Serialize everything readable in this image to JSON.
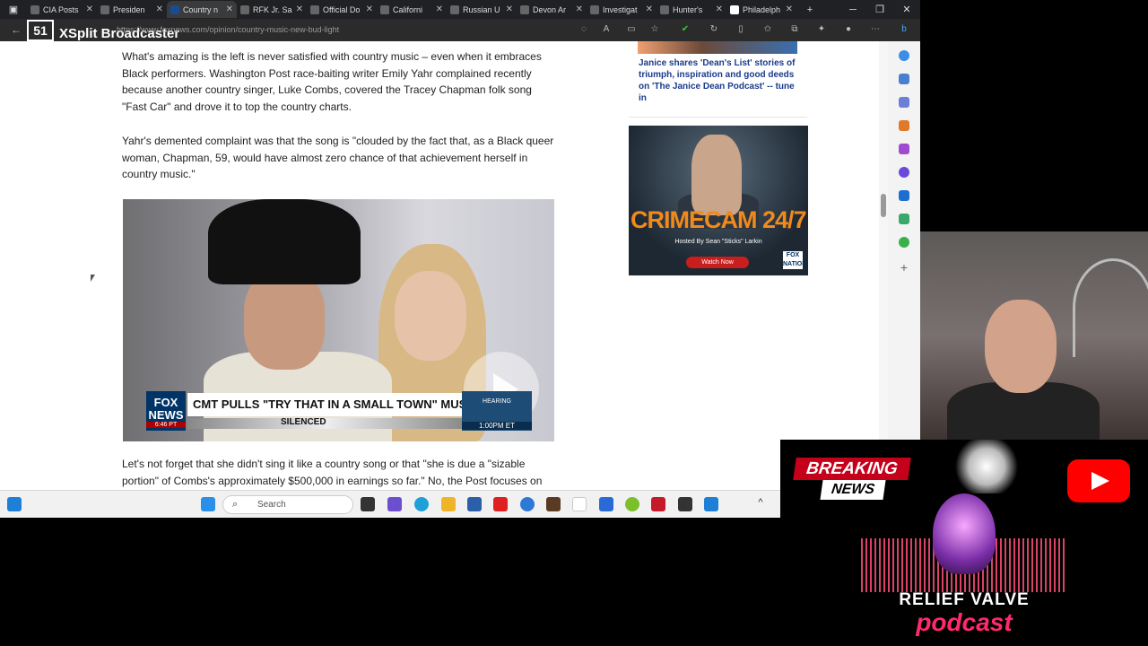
{
  "broadcaster": {
    "logo_text": "51",
    "name": "XSplit Broadcaster"
  },
  "tabs": [
    {
      "label": "CIA Posts",
      "active": false
    },
    {
      "label": "Presiden",
      "active": false
    },
    {
      "label": "Country n",
      "active": true
    },
    {
      "label": "RFK Jr. Sa",
      "active": false
    },
    {
      "label": "Official Do",
      "active": false
    },
    {
      "label": "Californi",
      "active": false
    },
    {
      "label": "Russian U",
      "active": false
    },
    {
      "label": "Devon Ar",
      "active": false
    },
    {
      "label": "Investigat",
      "active": false
    },
    {
      "label": "Hunter's",
      "active": false
    },
    {
      "label": "Philadelph",
      "active": false
    }
  ],
  "window_controls": {
    "minimize": "─",
    "restore": "❐",
    "close": "✕",
    "new_tab": "+"
  },
  "address_bar": {
    "url": "https://www.foxnews.com/opinion/country-music-new-bud-light"
  },
  "article": {
    "para1": "What's amazing is the left is never satisfied with country music – even when it embraces Black performers. Washington Post race-baiting writer Emily Yahr complained recently because another country singer, Luke Combs, covered the Tracey Chapman folk song \"Fast Car\" and drove it to top the country charts.",
    "para2": "Yahr's demented complaint was that the song is \"clouded by the fact that, as a Black queer woman, Chapman, 59, would have almost zero chance of that achievement herself in country music.\"",
    "para3": "Let's not forget that she didn't sing it like a country song or that \"she is due a \"sizable portion\" of Combs's approximately $500,000 in earnings so far.\" No, the Post focuses on"
  },
  "video": {
    "network": "FOX NEWS",
    "time_left": "6:46 PT",
    "headline": "CMT PULLS \"TRY THAT IN A SMALL TOWN\" MUSIC VIDEO",
    "subhead": "SILENCED",
    "bug_text": "HEARING",
    "bug_time": "1:00PM ET"
  },
  "sidebar": {
    "promo_text": "Janice shares 'Dean's List' stories of triumph, inspiration and good deeds on 'The Janice Dean Podcast' -- tune in",
    "ad_title": "CRIMECAM 24/7",
    "ad_sub": "Hosted By Sean \"Sticks\" Larkin",
    "ad_button": "Watch Now",
    "ad_network": "FOX NATION"
  },
  "taskbar": {
    "search_label": "Search"
  },
  "podcast": {
    "breaking": "BREAKING",
    "news": "NEWS",
    "title": "RELIEF VALVE",
    "subtitle": "podcast"
  }
}
